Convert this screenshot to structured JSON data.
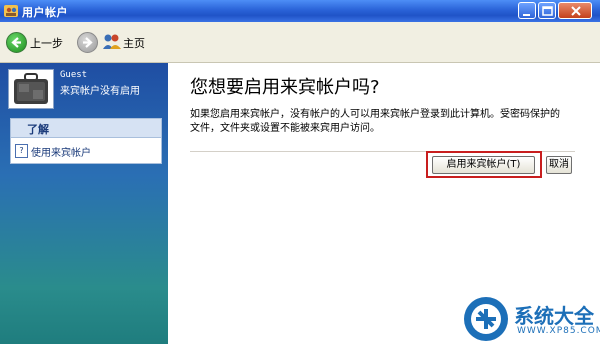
{
  "window": {
    "title": "用户帐户",
    "controls": [
      "minimize-icon",
      "maximize-icon",
      "close-icon"
    ]
  },
  "toolbar": {
    "back_label": "上一步",
    "home_label": "主页"
  },
  "sidebar": {
    "username": "Guest",
    "status": "来宾帐户没有启用",
    "learn_heading": "了解",
    "learn_item": "使用来宾帐户"
  },
  "main": {
    "heading": "您想要启用来宾帐户吗?",
    "description": "如果您启用来宾帐户，没有帐户的人可以用来宾帐户登录到此计算机。受密码保护的文件，文件夹或设置不能被来宾用户访问。",
    "enable_button": "启用来宾帐户(T)",
    "cancel_button": "取消"
  },
  "watermark": {
    "text": "系统大全",
    "url": "WWW.XP85.COM"
  },
  "colors": {
    "titlebar": "#2a63d8",
    "highlight": "#c81e1e",
    "watermark": "#1c6fb8"
  }
}
